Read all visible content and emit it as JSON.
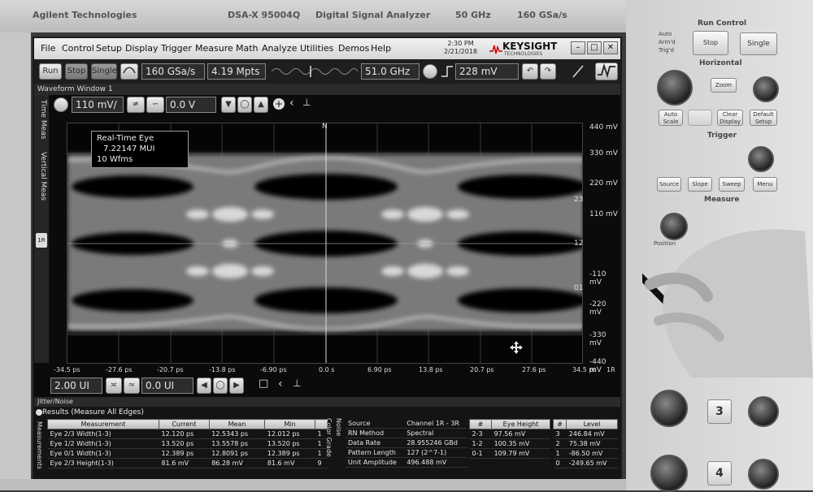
{
  "bezel": {
    "brand": "Agilent Technologies",
    "model": "DSA-X 95004Q",
    "type": "Digital Signal Analyzer",
    "bandwidth": "50 GHz",
    "sample_rate": "160 GSa/s"
  },
  "menu": {
    "items": [
      "File",
      "Control",
      "Setup",
      "Display",
      "Trigger",
      "Measure",
      "Math",
      "Analyze",
      "Utilities",
      "Demos",
      "Help"
    ],
    "time": "2:30 PM",
    "date": "2/21/2018",
    "logo": "KEYSIGHT",
    "logo_sub": "TECHNOLOGIES"
  },
  "toolbar": {
    "run": "Run",
    "stop": "Stop",
    "single": "Single",
    "sample_rate": "160 GSa/s",
    "memory": "4.19 Mpts",
    "bandwidth": "51.0 GHz",
    "trigger_level": "228 mV"
  },
  "window_title": "Waveform Window 1",
  "side_tabs": [
    "Time Meas",
    "Vertical Meas"
  ],
  "vertical": {
    "scale": "110 mV/",
    "offset": "0.0 V"
  },
  "eye_info": {
    "line1": "Real-Time Eye",
    "line2": "7.22147 MUI",
    "line3": "10 Wfms"
  },
  "marker": "N",
  "y_labels": [
    "440 mV",
    "330 mV",
    "220 mV",
    "110 mV",
    "",
    "-110 mV",
    "-220 mV",
    "-330 mV",
    "-440 mV"
  ],
  "right_markers": [
    "23",
    "12",
    "01"
  ],
  "x_labels": [
    "-34.5 ps",
    "-27.6 ps",
    "-20.7 ps",
    "-13.8 ps",
    "-6.90 ps",
    "0.0 s",
    "6.90 ps",
    "13.8 ps",
    "20.7 ps",
    "27.6 ps",
    "34.5 ps"
  ],
  "channel_tag": "1R",
  "horizontal": {
    "scale": "2.00 UI",
    "position": "0.0 UI"
  },
  "jitter_title": "Jitter/Noise",
  "results": {
    "title": "Results (Measure All Edges)",
    "side_label": "Measurements",
    "headers": [
      "Measurement",
      "Current",
      "Mean",
      "Min"
    ],
    "rows": [
      {
        "name": "Eye 2/3 Width(1-3)",
        "current": "12.120 ps",
        "mean": "12.5343 ps",
        "min": "12.012 ps",
        "n": "1"
      },
      {
        "name": "Eye 1/2 Width(1-3)",
        "current": "13.520 ps",
        "mean": "13.5578 ps",
        "min": "13.520 ps",
        "n": "1"
      },
      {
        "name": "Eye 0/1 Width(1-3)",
        "current": "12.389 ps",
        "mean": "12.8091 ps",
        "min": "12.389 ps",
        "n": "1"
      },
      {
        "name": "Eye 2/3 Height(1-3)",
        "current": "81.6 mV",
        "mean": "86.28 mV",
        "min": "81.6 mV",
        "n": "9"
      }
    ],
    "color_grade_label": "Color Grade",
    "noise_label": "Noise",
    "info_rows": [
      {
        "k": "Source",
        "v": "Channel 1R - 3R"
      },
      {
        "k": "RN Method",
        "v": "Spectral"
      },
      {
        "k": "Data Rate",
        "v": "28.955246 GBd"
      },
      {
        "k": "Pattern Length",
        "v": "127 (2^7-1)"
      },
      {
        "k": "Unit Amplitude",
        "v": "496.488 mV"
      }
    ],
    "eye_height_headers": [
      "#",
      "Eye Height"
    ],
    "eye_height_rows": [
      {
        "n": "2-3",
        "v": "97.56 mV"
      },
      {
        "n": "1-2",
        "v": "100.35 mV"
      },
      {
        "n": "0-1",
        "v": "109.79 mV"
      }
    ],
    "level_headers": [
      "#",
      "Level"
    ],
    "level_rows": [
      {
        "n": "3",
        "v": "246.84 mV"
      },
      {
        "n": "2",
        "v": "75.38 mV"
      },
      {
        "n": "1",
        "v": "-86.50 mV"
      },
      {
        "n": "0",
        "v": "-249.65 mV"
      }
    ]
  },
  "front_panel": {
    "run_control": "Run Control",
    "auto": "Auto",
    "armd": "Arm'd",
    "trigd": "Trig'd",
    "stop": "Stop",
    "single": "Single",
    "horizontal": "Horizontal",
    "zoom": "Zoom",
    "auto_scale": "Auto Scale",
    "clear_display": "Clear Display",
    "default_setup": "Default Setup",
    "trigger": "Trigger",
    "source": "Source",
    "slope": "Slope",
    "sweep": "Sweep",
    "menu": "Menu",
    "measure": "Measure",
    "position": "Position",
    "ch3": "3",
    "ch4": "4"
  }
}
